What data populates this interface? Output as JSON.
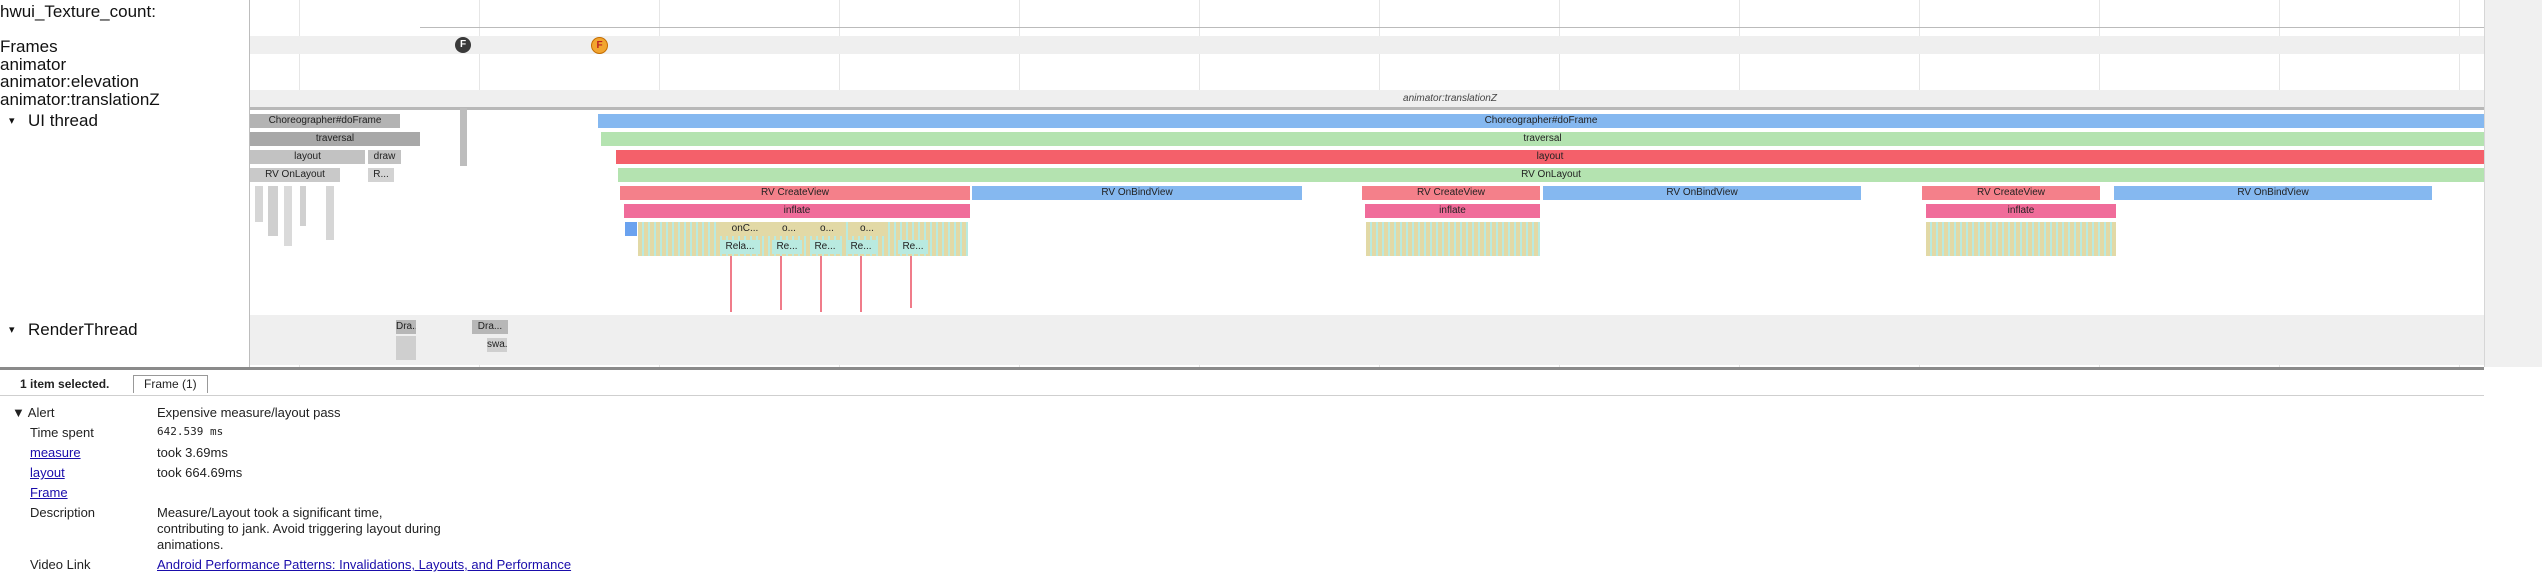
{
  "tracks": {
    "hwui_texture": "hwui_Texture_count:",
    "frames": "Frames",
    "animator": "animator",
    "animator_elevation": "animator:elevation",
    "animator_translationz": "animator:translationZ",
    "ui_thread": "UI thread",
    "render_thread": "RenderThread"
  },
  "frame_markers": {
    "f1": "F",
    "f2": "F"
  },
  "animator_slice": "animator:translationZ",
  "ui_slices": {
    "choreographer_small": "Choreographer#doFrame",
    "traversal_small": "traversal",
    "layout_small": "layout",
    "draw_small": "draw",
    "rv_onlayout_small": "RV OnLayout",
    "r_small": "R...",
    "choreographer": "Choreographer#doFrame",
    "traversal": "traversal",
    "layout": "layout",
    "rv_onlayout": "RV OnLayout",
    "rv_createview": "RV CreateView",
    "rv_onbindview": "RV OnBindView",
    "inflate": "inflate",
    "onc": "onC...",
    "o1": "o...",
    "o2": "o...",
    "o3": "o...",
    "rela": "Rela...",
    "re1": "Re...",
    "re2": "Re...",
    "re3": "Re...",
    "re4": "Re..."
  },
  "render_slices": {
    "dra1": "Dra...",
    "dra2": "Dra...",
    "swa": "swa..."
  },
  "selection": {
    "count_label": "1 item selected.",
    "tab": "Frame (1)"
  },
  "alert": {
    "header": "Alert",
    "title": "Expensive measure/layout pass",
    "rows": {
      "time_spent_key": "Time spent",
      "time_spent_val": "642.539 ms",
      "measure_key": "measure",
      "measure_val": "took 3.69ms",
      "layout_key": "layout",
      "layout_val": "took 664.69ms",
      "frame_key": "Frame",
      "description_key": "Description",
      "description_line1": "Measure/Layout took a significant time,",
      "description_line2": "contributing to jank. Avoid triggering layout during",
      "description_line3": "animations.",
      "video_key": "Video Link",
      "video_val": "Android Performance Patterns: Invalidations, Layouts, and Performance"
    }
  },
  "colors": {
    "blue": "#85b8f0",
    "green": "#b4e3b0",
    "red": "#f4606a",
    "pink": "#f07c8a",
    "beige": "#e2d9a6",
    "gray": "#b3b3b3",
    "frame_bad": "#f2a530",
    "frame_ok": "#3a3a3a"
  }
}
